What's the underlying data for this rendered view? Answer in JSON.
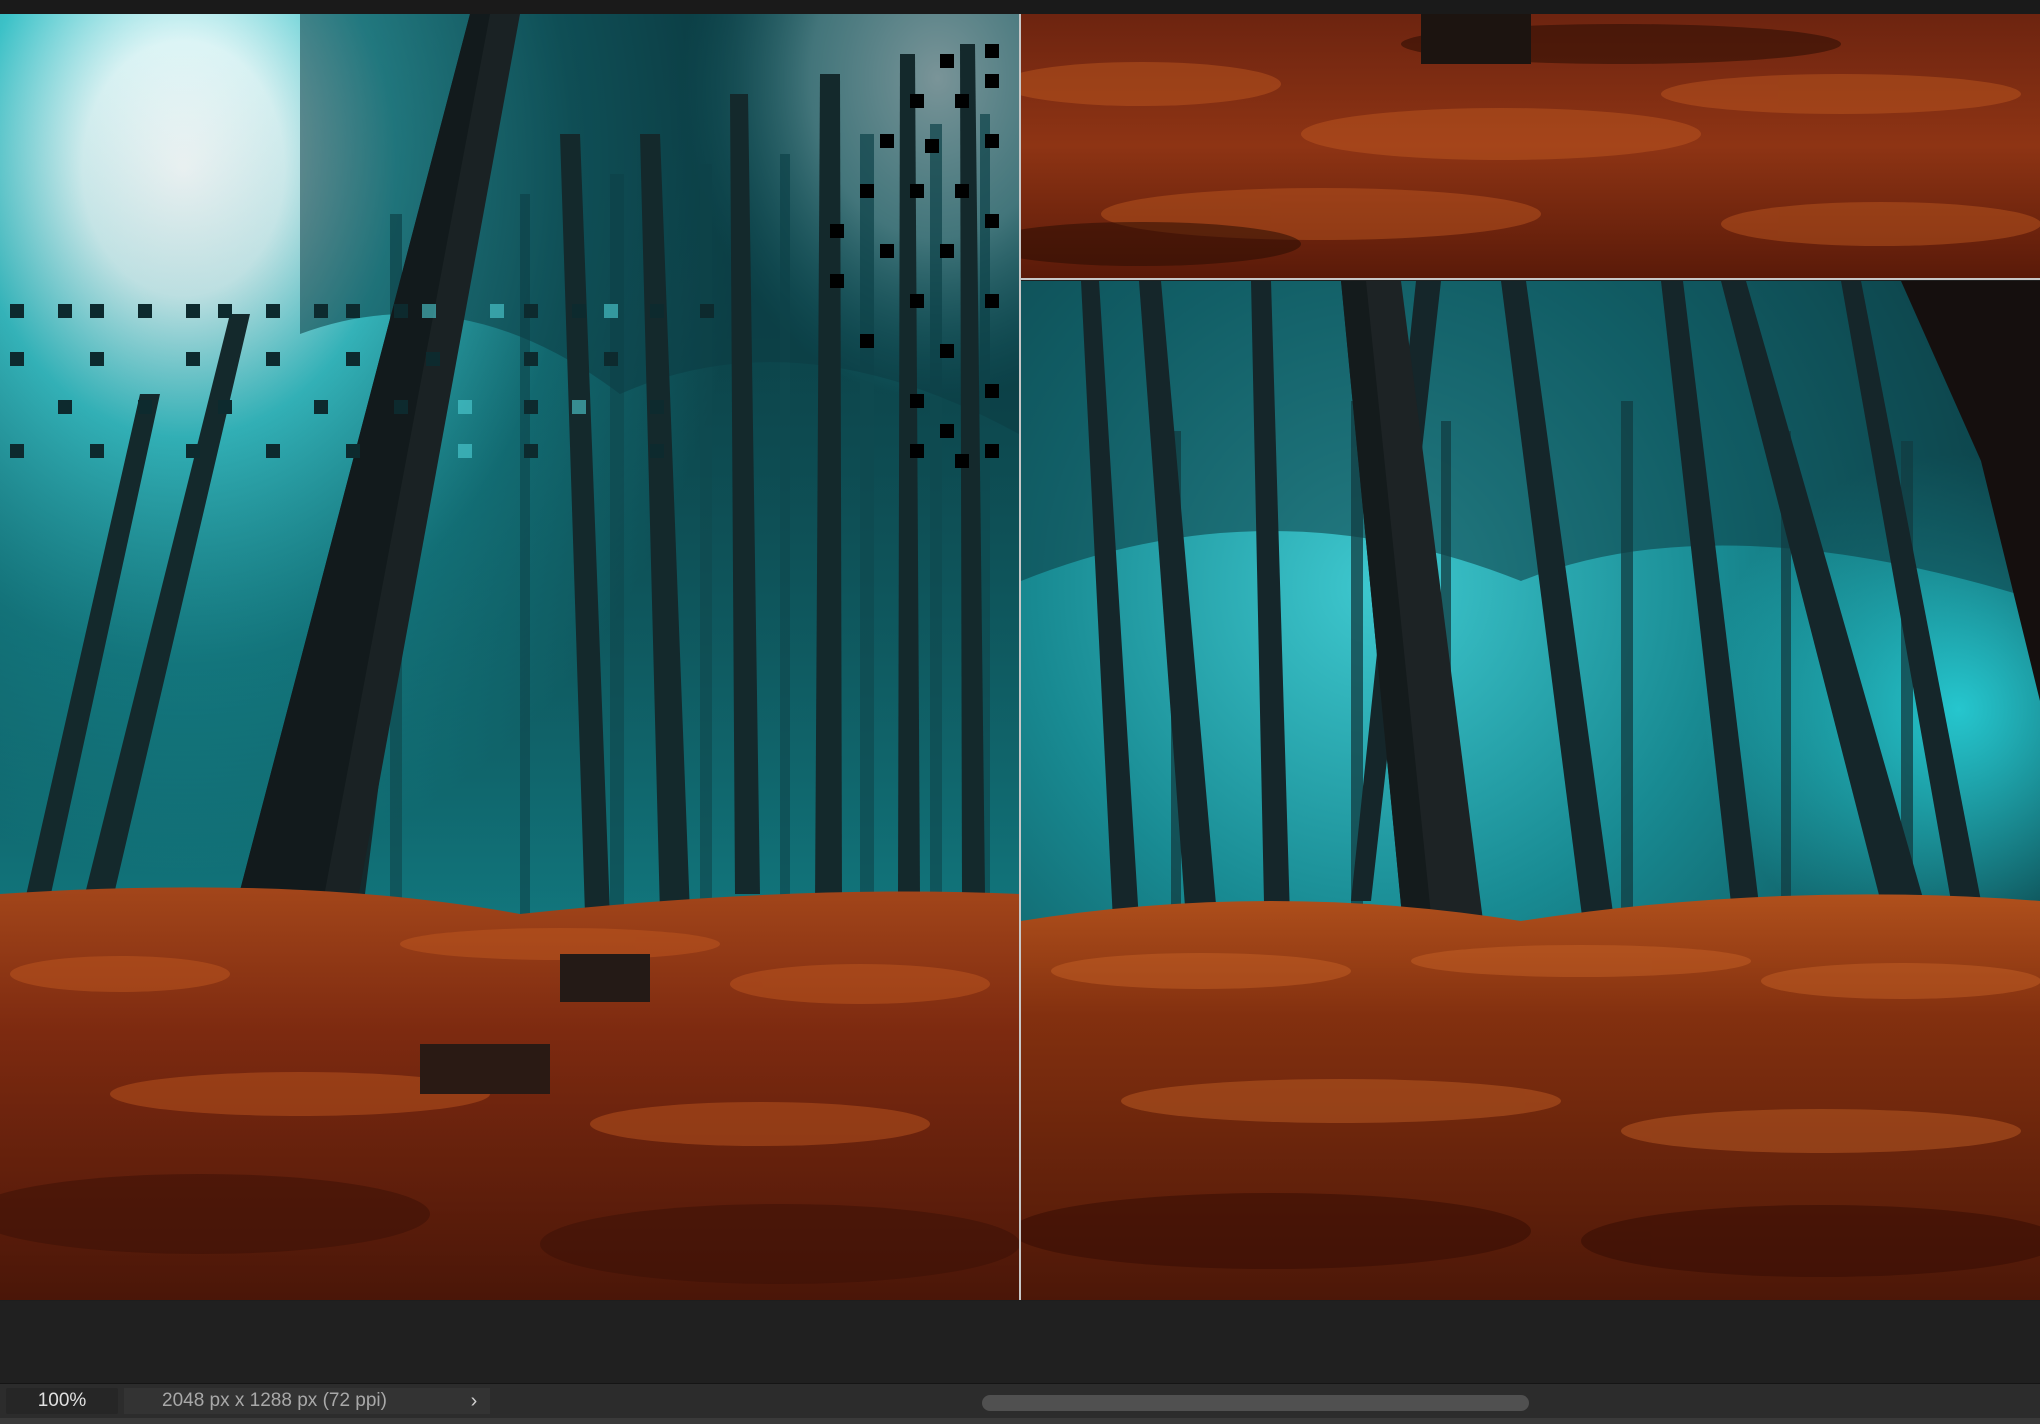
{
  "status_bar": {
    "zoom": "100%",
    "document_info": "2048 px x 1288 px (72 ppi)",
    "menu_arrow": "›"
  },
  "colors": {
    "fog_cyan": "#20c8d0",
    "forest_floor": "#8a2e10",
    "trunk_dark": "#1a2224",
    "ui_background": "#1e1e1e"
  },
  "icons": {
    "status_menu": "chevron-right-icon"
  }
}
